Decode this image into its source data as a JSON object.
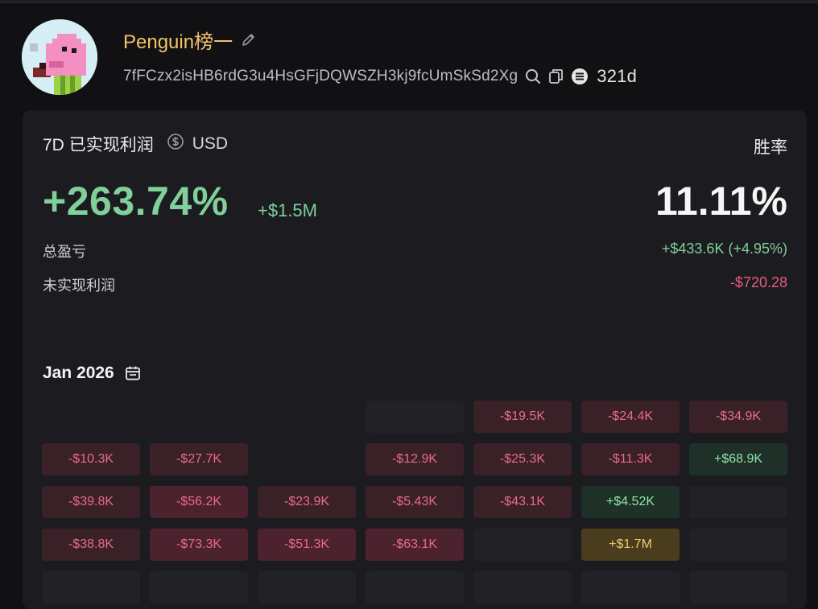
{
  "profile": {
    "name": "Penguin榜一",
    "address": "7fFCzx2isHB6rdG3u4HsGFjDQWSZH3kj9fcUmSkSd2Xg",
    "days": "321d",
    "icons": [
      "edit-icon",
      "search-icon",
      "copy-icon",
      "solana-icon"
    ]
  },
  "pnl_card": {
    "period": "7D",
    "title": "已实现利润",
    "currency": "USD",
    "realized_pct": "+263.74%",
    "realized_abs": "+$1.5M",
    "winrate_label": "胜率",
    "winrate_value": "11.11%",
    "total_pnl_label": "总盈亏",
    "total_pnl_value": "+$433.6K (+4.95%)",
    "unrealized_label": "未实现利润",
    "unrealized_value": "-$720.28"
  },
  "calendar": {
    "month": "Jan 2026",
    "rows": [
      [
        "",
        "",
        "",
        "",
        "-$19.5K",
        "-$24.4K",
        "-$34.9K"
      ],
      [
        "-$10.3K",
        "-$27.7K",
        "",
        "-$12.9K",
        "-$25.3K",
        "-$11.3K",
        "+$68.9K"
      ],
      [
        "-$39.8K",
        "-$56.2K",
        "-$23.9K",
        "-$5.43K",
        "-$43.1K",
        "+$4.52K",
        ""
      ],
      [
        "-$38.8K",
        "-$73.3K",
        "-$51.3K",
        "-$63.1K",
        "",
        "+$1.7M",
        ""
      ]
    ]
  },
  "colors": {
    "accent_gold": "#f2c26a",
    "profit_green": "#7fd09a",
    "loss_red": "#ea5c79"
  }
}
